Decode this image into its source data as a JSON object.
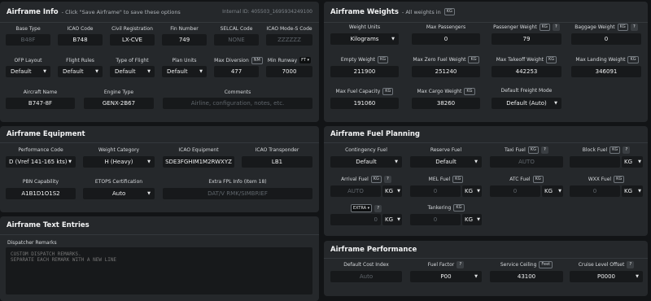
{
  "airframe_info": {
    "title": "Airframe Info",
    "subtitle": "- Click \"Save Airframe\" to save these options",
    "internal_id": "Internal ID: 405503_1695934249100",
    "fields": {
      "base_type": {
        "label": "Base Type",
        "value": "B48F"
      },
      "icao_code": {
        "label": "ICAO Code",
        "value": "B748"
      },
      "civil_reg": {
        "label": "Civil Registration",
        "value": "LX-CVE"
      },
      "fin_number": {
        "label": "Fin Number",
        "value": "749"
      },
      "selcal": {
        "label": "SELCAL Code",
        "value": "NONE"
      },
      "mode_s": {
        "label": "ICAO Mode-S Code",
        "value": "ZZZZZZ"
      },
      "ofp_layout": {
        "label": "OFP Layout",
        "value": "Default"
      },
      "flight_rules": {
        "label": "Flight Rules",
        "value": "Default"
      },
      "type_of_flight": {
        "label": "Type of Flight",
        "value": "Default"
      },
      "plan_units": {
        "label": "Plan Units",
        "value": "Default"
      },
      "max_diversion": {
        "label": "Max Diversion",
        "unit": "NM",
        "value": "477"
      },
      "min_runway": {
        "label": "Min Runway",
        "unit": "FT",
        "value": "7000"
      },
      "aircraft_name": {
        "label": "Aircraft Name",
        "value": "B747-8F"
      },
      "engine_type": {
        "label": "Engine Type",
        "value": "GENX-2B67"
      },
      "comments": {
        "label": "Comments",
        "placeholder": "Airline, configuration, notes, etc."
      }
    }
  },
  "airframe_weights": {
    "title": "Airframe Weights",
    "subtitle": "- All weights in",
    "unit": "KG",
    "fields": {
      "weight_units": {
        "label": "Weight Units",
        "value": "Kilograms"
      },
      "max_passengers": {
        "label": "Max Passengers",
        "value": "0"
      },
      "passenger_weight": {
        "label": "Passenger Weight",
        "unit": "KG",
        "value": "79"
      },
      "baggage_weight": {
        "label": "Baggage Weight",
        "unit": "KG",
        "value": "0"
      },
      "empty_weight": {
        "label": "Empty Weight",
        "unit": "KG",
        "value": "211900"
      },
      "mzfw": {
        "label": "Max Zero Fuel Weight",
        "unit": "KG",
        "value": "251240"
      },
      "mtow": {
        "label": "Max Takeoff Weight",
        "unit": "KG",
        "value": "442253"
      },
      "mlw": {
        "label": "Max Landing Weight",
        "unit": "KG",
        "value": "346091"
      },
      "max_fuel": {
        "label": "Max Fuel Capacity",
        "unit": "KG",
        "value": "191060"
      },
      "max_cargo": {
        "label": "Max Cargo Weight",
        "unit": "KG",
        "value": "38260"
      },
      "freight_mode": {
        "label": "Default Freight Mode",
        "value": "Default (Auto)"
      }
    }
  },
  "airframe_equipment": {
    "title": "Airframe Equipment",
    "fields": {
      "perf_code": {
        "label": "Performance Code",
        "value": "D (Vref 141-165 kts)"
      },
      "weight_cat": {
        "label": "Weight Category",
        "value": "H (Heavy)"
      },
      "icao_equip": {
        "label": "ICAO Equipment",
        "value": "SDE3FGHIM1M2RWXYZ"
      },
      "icao_transponder": {
        "label": "ICAO Transponder",
        "value": "LB1"
      },
      "pbn": {
        "label": "PBN Capability",
        "value": "A1B1D1O1S2"
      },
      "etops": {
        "label": "ETOPS Certification",
        "value": "Auto"
      },
      "extra_fpl": {
        "label": "Extra FPL Info (Item 18)",
        "placeholder": "DAT/V RMK/SIMBRIEF"
      }
    }
  },
  "fuel_planning": {
    "title": "Airframe Fuel Planning",
    "fields": {
      "contingency": {
        "label": "Contingency Fuel",
        "value": "Default"
      },
      "reserve": {
        "label": "Reserve Fuel",
        "value": "Default"
      },
      "taxi": {
        "label": "Taxi Fuel",
        "unit": "KG",
        "placeholder": "AUTO"
      },
      "block": {
        "label": "Block Fuel",
        "unit": "KG",
        "value": "",
        "select": "KG"
      },
      "arrival": {
        "label": "Arrival Fuel",
        "unit": "KG",
        "placeholder": "AUTO",
        "select": "KG"
      },
      "mel": {
        "label": "MEL Fuel",
        "unit": "KG",
        "placeholder": "0",
        "select": "KG"
      },
      "atc": {
        "label": "ATC Fuel",
        "unit": "KG",
        "placeholder": "0",
        "select": "KG"
      },
      "wxx": {
        "label": "WXX Fuel",
        "unit": "KG",
        "placeholder": "0",
        "select": "KG"
      },
      "extra": {
        "label": "EXTRA",
        "placeholder": "0",
        "select": "KG"
      },
      "tankering": {
        "label": "Tankering",
        "unit": "KG",
        "placeholder": "0",
        "select": "KG"
      }
    }
  },
  "text_entries": {
    "title": "Airframe Text Entries",
    "dispatcher_label": "Dispatcher Remarks",
    "dispatcher_placeholder": "CUSTOM DISPATCH REMARKS.\nSEPARATE EACH REMARK WITH A NEW LINE"
  },
  "performance": {
    "title": "Airframe Performance",
    "fields": {
      "cost_index": {
        "label": "Default Cost Index",
        "placeholder": "Auto"
      },
      "fuel_factor": {
        "label": "Fuel Factor",
        "value": "P00"
      },
      "ceiling": {
        "label": "Service Ceiling",
        "unit": "Feet",
        "value": "43100"
      },
      "cruise_offset": {
        "label": "Cruise Level Offset",
        "value": "P0000"
      }
    }
  }
}
